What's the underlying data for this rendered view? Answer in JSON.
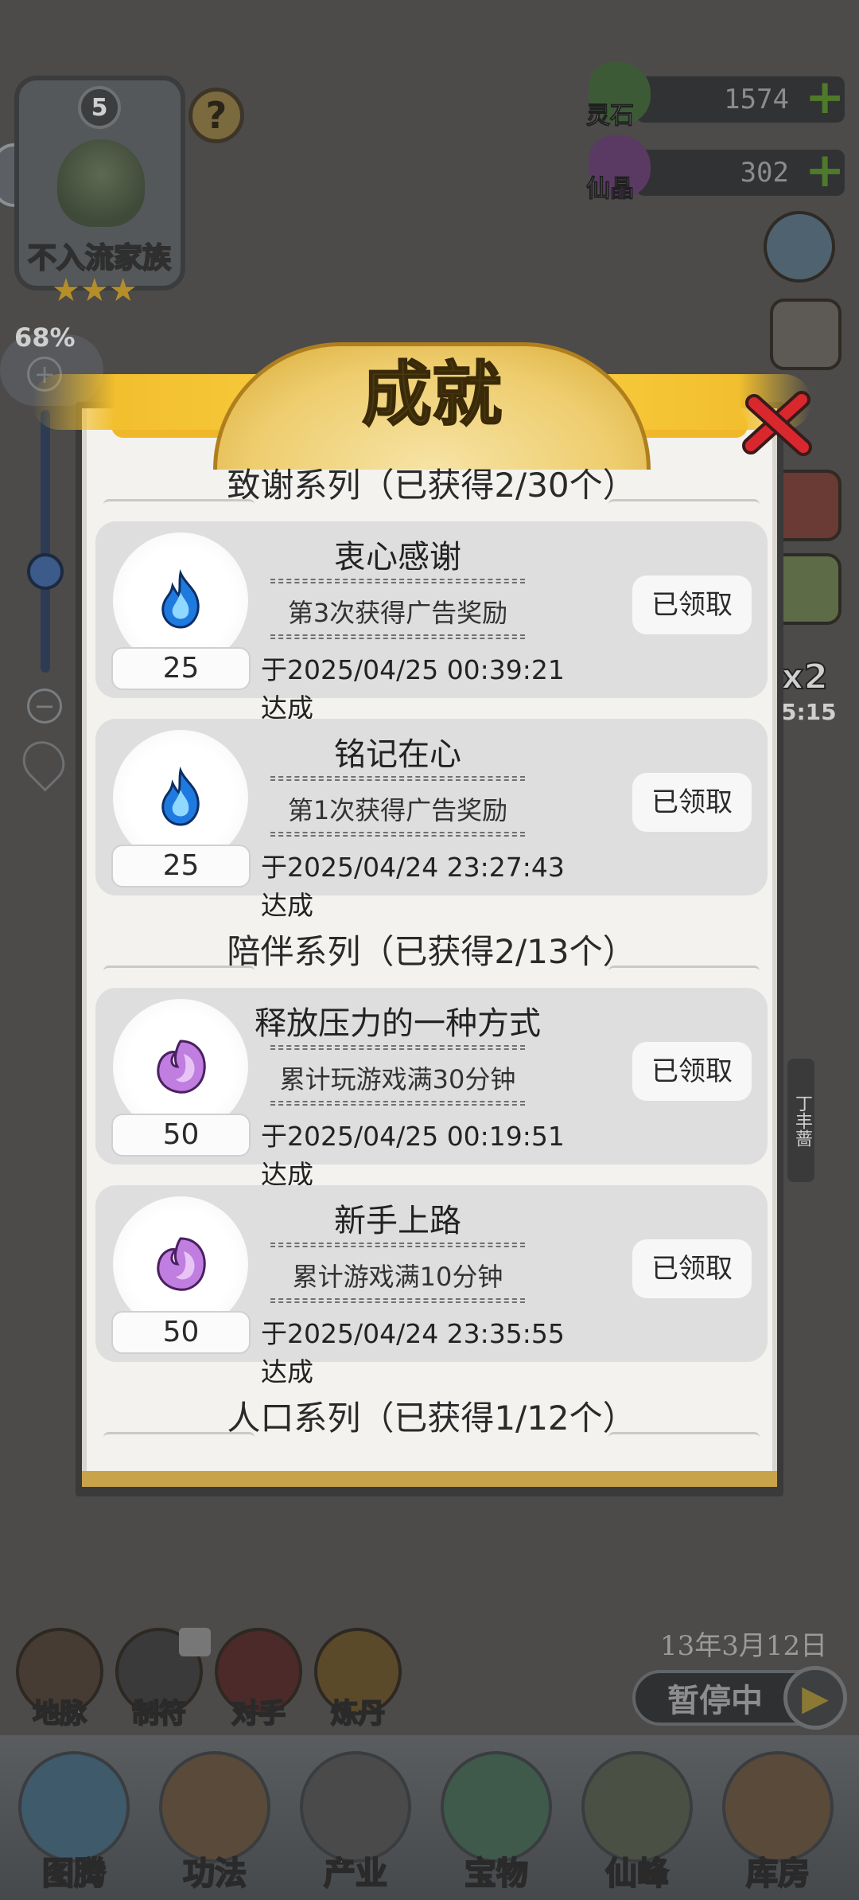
{
  "hud": {
    "family_level": "5",
    "family_name": "不入流家族",
    "stars": "★★★",
    "help_label": "?",
    "zoom_percent": "68%",
    "zoom_plus": "+",
    "zoom_minus": "−",
    "zoom_level": 0.68,
    "resources": [
      {
        "label": "灵石",
        "value": "1574",
        "plus": "+"
      },
      {
        "label": "仙晶",
        "value": "302",
        "plus": "+"
      }
    ],
    "speed_badge": "x2",
    "speed_timer": "5:15",
    "date": "13年3月12日",
    "pause_label": "暂停中",
    "mini_buttons": [
      "地脉",
      "制符",
      "对手",
      "炼丹"
    ],
    "nav": [
      "图腾",
      "功法",
      "产业",
      "宝物",
      "仙峰",
      "库房"
    ],
    "side_tag": "丁丰蔷"
  },
  "modal": {
    "title": "成就",
    "sections": [
      {
        "header": "致谢系列（已获得2/30个）",
        "cards": [
          {
            "title": "衷心感谢",
            "desc": "第3次获得广告奖励",
            "reward": "25",
            "date": "于2025/04/25 00:39:21达成",
            "button": "已领取",
            "icon": "blue-flame-icon"
          },
          {
            "title": "铭记在心",
            "desc": "第1次获得广告奖励",
            "reward": "25",
            "date": "于2025/04/24 23:27:43达成",
            "button": "已领取",
            "icon": "blue-flame-icon"
          }
        ]
      },
      {
        "header": "陪伴系列（已获得2/13个）",
        "cards": [
          {
            "title": "释放压力的一种方式",
            "desc": "累计玩游戏满30分钟",
            "reward": "50",
            "date": "于2025/04/25 00:19:51达成",
            "button": "已领取",
            "icon": "purple-crystal-icon"
          },
          {
            "title": "新手上路",
            "desc": "累计游戏满10分钟",
            "reward": "50",
            "date": "于2025/04/24 23:35:55达成",
            "button": "已领取",
            "icon": "purple-crystal-icon"
          }
        ]
      },
      {
        "header": "人口系列（已获得1/12个）",
        "cards": []
      }
    ]
  },
  "colors": {
    "background": "#4c4b4a",
    "panel": "#f3f2ef",
    "card": "#dedede",
    "title_gold": "#eecd6e",
    "close_red": "#d8282e",
    "blue_flame": "#3aa0ff",
    "purple_crystal": "#b873d9"
  }
}
